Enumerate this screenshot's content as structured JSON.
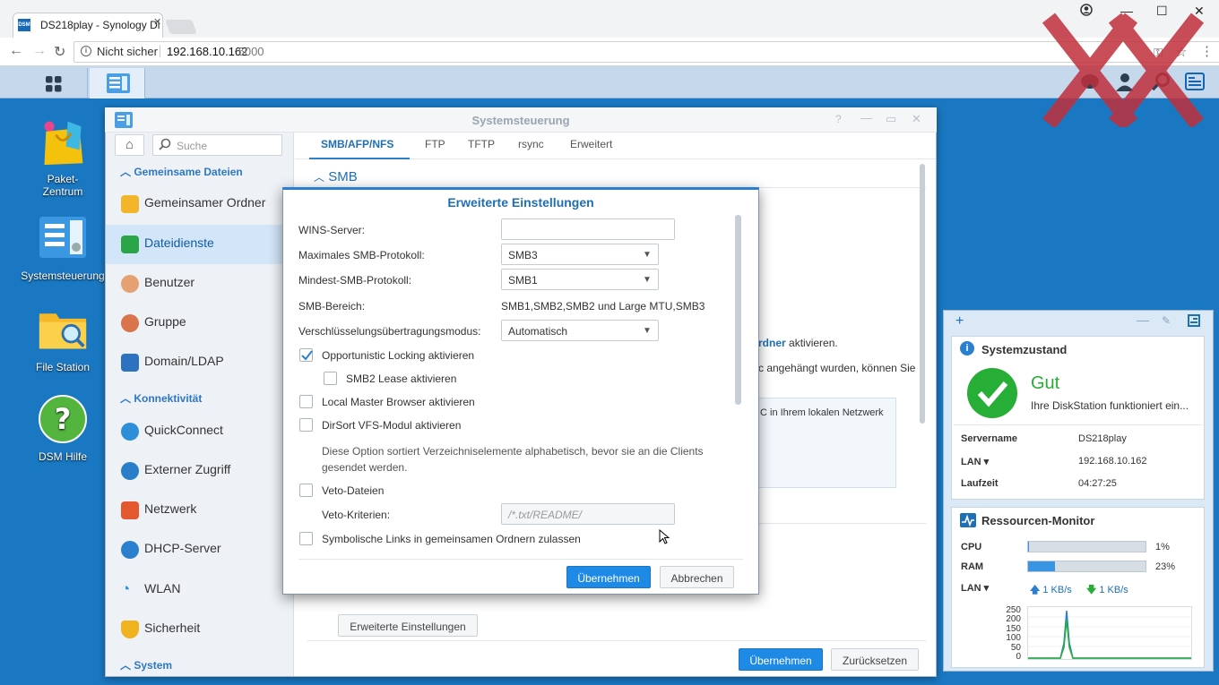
{
  "browser": {
    "tab_title": "DS218play - Synology Di",
    "tab_favicon_text": "DSM",
    "not_secure": "Nicht sicher",
    "url_host": "192.168.10.162",
    "url_port": ":5000"
  },
  "desktop": {
    "icons": [
      {
        "label": "Paket-\nZentrum"
      },
      {
        "label": "Systemsteuerung"
      },
      {
        "label": "File Station"
      },
      {
        "label": "DSM Hilfe"
      }
    ]
  },
  "window": {
    "title": "Systemsteuerung",
    "search_placeholder": "Suche",
    "sections": {
      "shared": "Gemeinsame Dateien",
      "connectivity": "Konnektivität",
      "system": "System"
    },
    "sidebar_items": [
      "Gemeinsamer Ordner",
      "Dateidienste",
      "Benutzer",
      "Gruppe",
      "Domain/LDAP",
      "QuickConnect",
      "Externer Zugriff",
      "Netzwerk",
      "DHCP-Server",
      "WLAN",
      "Sicherheit"
    ],
    "tabs": [
      "SMB/AFP/NFS",
      "FTP",
      "TFTP",
      "rsync",
      "Erweitert"
    ],
    "smb_heading": "SMB",
    "bg_text_1_bold": "rdner",
    "bg_text_1": " aktivieren.",
    "bg_text_2": "c angehängt wurden, können Sie",
    "bg_text_3": "C in Ihrem lokalen Netzwerk",
    "advanced_button": "Erweiterte Einstellungen",
    "apply": "Übernehmen",
    "reset": "Zurücksetzen"
  },
  "modal": {
    "title": "Erweiterte Einstellungen",
    "wins_label": "WINS-Server:",
    "wins_value": "",
    "max_smb_label": "Maximales SMB-Protokoll:",
    "max_smb_value": "SMB3",
    "min_smb_label": "Mindest-SMB-Protokoll:",
    "min_smb_value": "SMB1",
    "smb_range_label": "SMB-Bereich:",
    "smb_range_value": "SMB1,SMB2,SMB2 und Large MTU,SMB3",
    "encryption_label": "Verschlüsselungsübertragungsmodus:",
    "encryption_value": "Automatisch",
    "oplock": "Opportunistic Locking aktivieren",
    "smb2_lease": "SMB2 Lease aktivieren",
    "local_master": "Local Master Browser aktivieren",
    "dirsort": "DirSort VFS-Modul aktivieren",
    "dirsort_desc": "Diese Option sortiert Verzeichniselemente alphabetisch, bevor sie an die Clients gesendet werden.",
    "veto_files": "Veto-Dateien",
    "veto_criteria_label": "Veto-Kriterien:",
    "veto_placeholder": "/*.txt/README/",
    "symlinks": "Symbolische Links in gemeinsamen Ordnern zulassen",
    "apply": "Übernehmen",
    "cancel": "Abbrechen",
    "oplock_checked": true
  },
  "widgets": {
    "health": {
      "title": "Systemzustand",
      "status": "Gut",
      "message": "Ihre DiskStation funktioniert ein...",
      "server_label": "Servername",
      "server_value": "DS218play",
      "lan_label": "LAN",
      "lan_value": "192.168.10.162",
      "uptime_label": "Laufzeit",
      "uptime_value": "04:27:25"
    },
    "resources": {
      "title": "Ressourcen-Monitor",
      "cpu_label": "CPU",
      "cpu_value": "1%",
      "cpu_fraction": 0.01,
      "ram_label": "RAM",
      "ram_value": "23%",
      "ram_fraction": 0.23,
      "lan_label": "LAN",
      "up": "1 KB/s",
      "down": "1 KB/s",
      "y_ticks": [
        "250",
        "200",
        "150",
        "100",
        "50",
        "0"
      ]
    }
  },
  "colors": {
    "accent": "#2b7fcf",
    "desktop": "#1a78c2",
    "ok_green": "#27ae36"
  }
}
